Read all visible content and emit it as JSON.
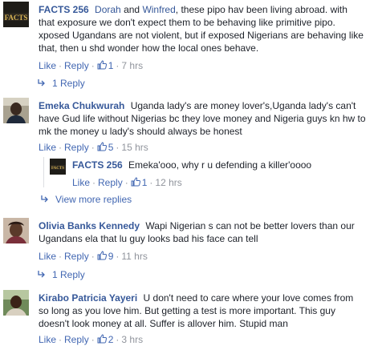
{
  "labels": {
    "like": "Like",
    "reply": "Reply"
  },
  "comments": [
    {
      "author": "FACTS 256",
      "mention1": "Dorah",
      "joiner": " and ",
      "mention2": "Winfred",
      "text": ", these pipo hav been living abroad. with that exposure we don't expect them to be behaving like primitive pipo. xposed Ugandans are not violent, but if exposed Nigerians are behaving like that, then u shd wonder how the local ones behave.",
      "likes": "1",
      "time": "7 hrs",
      "replies_link": "1 Reply"
    },
    {
      "author": "Emeka Chukwurah",
      "text": "Uganda lady's are money lover's,Uganda lady's can't have Gud life without Nigerias bc they love money and Nigeria guys kn hw to mk the money u lady's should always be honest",
      "likes": "5",
      "time": "15 hrs",
      "reply": {
        "author": "FACTS 256",
        "text": "Emeka'ooo, why r u defending a killer'oooo",
        "likes": "1",
        "time": "12 hrs"
      },
      "replies_link": "View more replies"
    },
    {
      "author": "Olivia Banks Kennedy",
      "text": "Wapi Nigerian s can not be better lovers than our Ugandans ela that lu guy looks bad his face can tell",
      "likes": "9",
      "time": "11 hrs",
      "replies_link": "1 Reply"
    },
    {
      "author": "Kirabo Patricia Yayeri",
      "text": "U don't need to care where your love comes from so long as you love him. But getting a test is more important. This guy doesn't look money at all. Suffer is allover him. Stupid man",
      "likes": "2",
      "time": "3 hrs"
    }
  ],
  "colors": {
    "link": "#365899",
    "action": "#4267b2",
    "meta": "#90949c",
    "text": "#1d2129"
  },
  "icons": {
    "like": "thumbs-up-icon",
    "reply_arrow": "reply-arrow-icon"
  },
  "avatars": {
    "facts": "FACTS"
  }
}
